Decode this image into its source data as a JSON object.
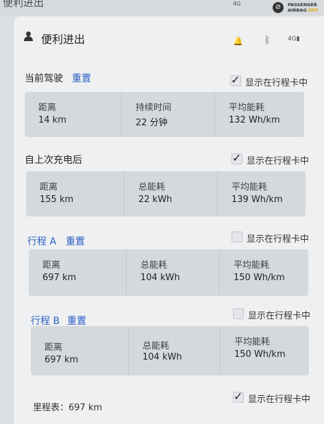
{
  "window_title": "便利进出",
  "status": {
    "signal": "4G",
    "airbag_line1": "PASSENGER",
    "airbag_line2": "AIRBAG",
    "airbag_state": "OFF"
  },
  "header": {
    "title": "便利进出",
    "icons": [
      "bell-icon",
      "bluetooth-icon",
      "lte-signal-icon"
    ]
  },
  "sections": [
    {
      "title": "当前驾驶",
      "reset": "重置",
      "checkbox_label": "显示在行程卡中",
      "checked": true,
      "cells": [
        {
          "label": "距离",
          "value": "14 km"
        },
        {
          "label": "持续时间",
          "value": "22 分钟"
        },
        {
          "label": "平均能耗",
          "value": "132 Wh/km"
        }
      ]
    },
    {
      "title": "自上次充电后",
      "reset": "",
      "checkbox_label": "显示在行程卡中",
      "checked": true,
      "cells": [
        {
          "label": "距离",
          "value": "155 km"
        },
        {
          "label": "总能耗",
          "value": "22 kWh"
        },
        {
          "label": "平均能耗",
          "value": "139 Wh/km"
        }
      ]
    },
    {
      "title": "行程 A",
      "reset": "重置",
      "checkbox_label": "显示在行程卡中",
      "checked": false,
      "cells": [
        {
          "label": "距离",
          "value": "697 km"
        },
        {
          "label": "总能耗",
          "value": "104 kWh"
        },
        {
          "label": "平均能耗",
          "value": "150 Wh/km"
        }
      ]
    },
    {
      "title": "行程 B",
      "reset": "重置",
      "checkbox_label": "显示在行程卡中",
      "checked": false,
      "cells": [
        {
          "label": "距离",
          "value": "697 km"
        },
        {
          "label": "总能耗",
          "value": "104 kWh"
        },
        {
          "label": "平均能耗",
          "value": "150 Wh/km"
        }
      ]
    }
  ],
  "odometer": {
    "label": "里程表：697 km",
    "checkbox_label": "显示在行程卡中",
    "checked": true
  },
  "colors": {
    "accent": "#2b5fc2",
    "card": "#d6d9dc",
    "panel": "#eef0f2"
  }
}
